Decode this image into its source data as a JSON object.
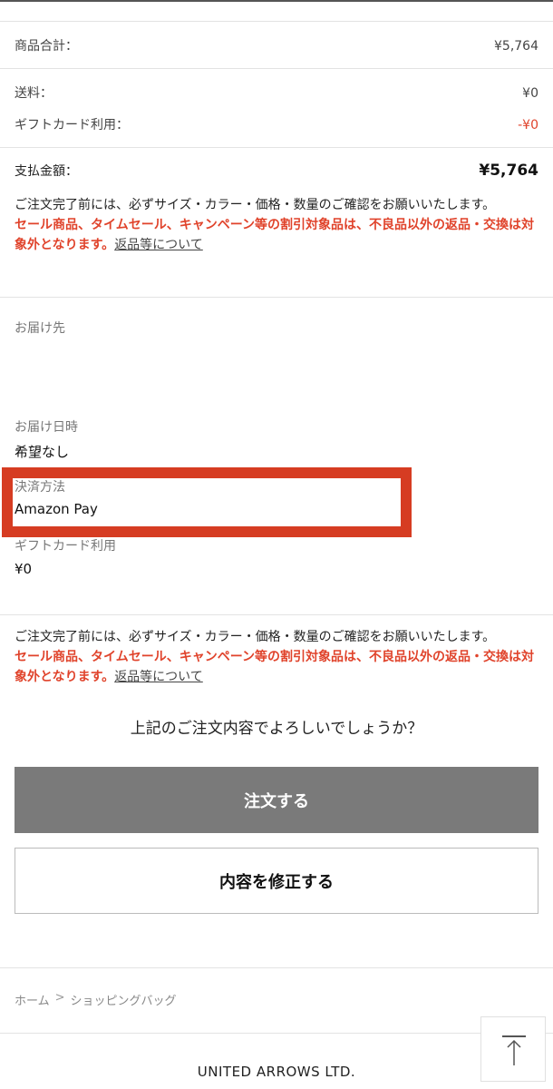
{
  "summary": {
    "subtotal_label": "商品合計：",
    "subtotal_value": "¥5,764",
    "shipping_label": "送料：",
    "shipping_value": "¥0",
    "giftcard_label": "ギフトカード利用：",
    "giftcard_value": "-¥0",
    "total_label": "支払金額：",
    "total_value": "¥5,764"
  },
  "notice": {
    "text": "ご注文完了前には、必ずサイズ・カラー・価格・数量のご確認をお願いいたします。",
    "warning": "セール商品、タイムセール、キャンペーン等の割引対象品は、不良品以外の返品・交換は対象外となります。",
    "link": "返品等について"
  },
  "delivery": {
    "address_label": "お届け先",
    "date_label": "お届け日時",
    "date_value": "希望なし",
    "payment_label": "決済方法",
    "payment_value": "Amazon Pay",
    "giftcard_label": "ギフトカード利用",
    "giftcard_value": "¥0"
  },
  "confirm_question": "上記のご注文内容でよろしいでしょうか？",
  "buttons": {
    "order": "注文する",
    "edit": "内容を修正する"
  },
  "breadcrumb": {
    "home": "ホーム",
    "separator": ">",
    "current": "ショッピングバッグ"
  },
  "footer": {
    "brand": "UNITED ARROWS LTD."
  },
  "icons": {
    "page_top": "arrow-up-icon"
  },
  "colors": {
    "warning": "#e0432b",
    "highlight": "#d63c22",
    "order_button": "#7a7a7a"
  }
}
